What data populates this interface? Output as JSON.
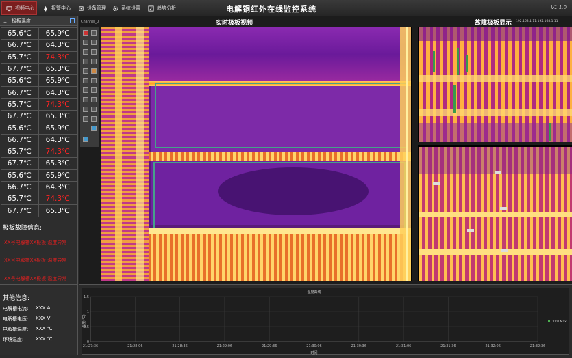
{
  "app": {
    "title": "电解铜红外在线监控系统",
    "version": "V1.1.0",
    "tabs": [
      {
        "label": "视频中心",
        "icon": "video-monitor-icon",
        "active": true
      },
      {
        "label": "报警中心",
        "icon": "alarm-bell-icon",
        "active": false
      },
      {
        "label": "设备管理",
        "icon": "device-icon",
        "active": false
      },
      {
        "label": "系统设置",
        "icon": "gear-icon",
        "active": false
      },
      {
        "label": "趋势分析",
        "icon": "edit-chart-icon",
        "active": false
      }
    ]
  },
  "left_panel": {
    "temp_header": "极板温度",
    "temperatures": [
      [
        "65.6℃",
        "65.9℃"
      ],
      [
        "66.7℃",
        "64.3℃"
      ],
      [
        "65.7℃",
        "74.3℃"
      ],
      [
        "67.7℃",
        "65.3℃"
      ],
      [
        "65.6℃",
        "65.9℃"
      ],
      [
        "66.7℃",
        "64.3℃"
      ],
      [
        "65.7℃",
        "74.3℃"
      ],
      [
        "67.7℃",
        "65.3℃"
      ],
      [
        "65.6℃",
        "65.9℃"
      ],
      [
        "66.7℃",
        "64.3℃"
      ],
      [
        "65.7℃",
        "74.3℃"
      ],
      [
        "67.7℃",
        "65.3℃"
      ],
      [
        "65.6℃",
        "65.9℃"
      ],
      [
        "66.7℃",
        "64.3℃"
      ],
      [
        "65.7℃",
        "74.3℃"
      ],
      [
        "67.7℃",
        "65.3℃"
      ]
    ],
    "hot_color": "#ff2424",
    "fault_title": "极板故障信息:",
    "fault_lines": [
      "XX号电解槽XX极板 温度异常",
      "XX号电解槽XX极板 温度异常",
      "XX号电解槽XX极板 温度异常"
    ],
    "other_title": "其他信息:",
    "other_info": [
      {
        "label": "电解槽电流:",
        "value": "XXX A"
      },
      {
        "label": "电解槽电压:",
        "value": "XXX V"
      },
      {
        "label": "电解槽温度:",
        "value": "XXX ℃"
      },
      {
        "label": "环境温度:",
        "value": "XXX ℃"
      }
    ]
  },
  "video": {
    "title": "实时极板视频",
    "channel": "Channel_0",
    "fault_title": "故障极板显示",
    "ip": "192.168.1.11:192.168.1.11"
  },
  "chart_data": {
    "type": "line",
    "title": "温度曲线",
    "xlabel": "时间",
    "ylabel": "温度(℃)",
    "x": [
      "21:27:36",
      "21:28:06",
      "21:28:36",
      "21:29:06",
      "21:29:36",
      "21:30:06",
      "21:30:36",
      "21:31:06",
      "21:31:36",
      "21:32:06",
      "21:32:36"
    ],
    "yticks": [
      "0",
      "0.5",
      "1",
      "1.5"
    ],
    "ylim": [
      0,
      1.5
    ],
    "grid": true,
    "series": [
      {
        "name": "11:0 Max",
        "values": []
      }
    ],
    "legend": "right"
  }
}
